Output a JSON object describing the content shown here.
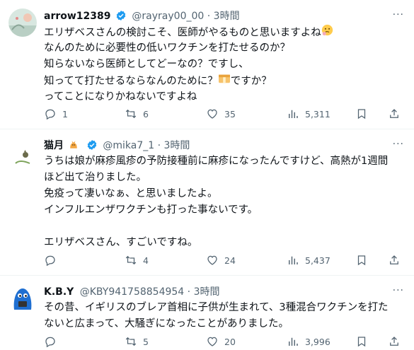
{
  "tweets": [
    {
      "name": "arrow12389",
      "handle": "@rayray00_00",
      "dot": "·",
      "time": "3時間",
      "lines": [
        "エリザベスさんの検討こそ、医師がやるものと思いますよね",
        "なんのために必要性の低いワクチンを打たせるのか？",
        "知らないなら医師としてどーなの？ですし、",
        "知ってて打たせるならなんのために？",
        "ですか？",
        "ってことになりかねないですよね"
      ],
      "emoji": [
        "thinking-face-emoji",
        "money-bag-emoji"
      ],
      "replies": "1",
      "reposts": "6",
      "likes": "35",
      "views": "5,311"
    },
    {
      "name": "猫月",
      "handle": "@mika7_1",
      "dot": "·",
      "time": "3時間",
      "lines": [
        "うちは娘が麻疹風疹の予防接種前に麻疹になったんですけど、高熱が1週間",
        "ほど出て治りました。",
        "免疫って凄いなぁ、と思いましたよ。",
        "インフルエンザワクチンも打った事ないです。",
        "",
        "エリザベスさん、すごいですね。"
      ],
      "emoji": [
        "cat-emoji"
      ],
      "replies": "",
      "reposts": "4",
      "likes": "24",
      "views": "5,437"
    },
    {
      "name": "K.B.Y",
      "handle": "@KBY941758854954",
      "dot": "·",
      "time": "3時間",
      "lines": [
        "その昔、イギリスのブレア首相に子供が生まれて、3種混合ワクチンを打た",
        "ないと広まって、大騒ぎになったことがありました。"
      ],
      "emoji": [],
      "replies": "",
      "reposts": "5",
      "likes": "20",
      "views": "3,996"
    }
  ],
  "more_label": "···",
  "colors": {
    "text": "#0f1419",
    "secondary": "#536471",
    "verified": "#1d9bf0",
    "divider": "#eff3f4"
  }
}
